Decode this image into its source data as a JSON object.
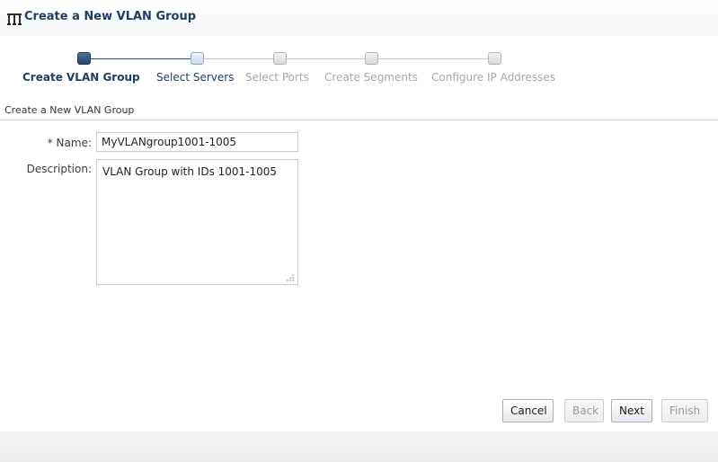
{
  "dialog": {
    "title": "Create a New VLAN Group",
    "icon": "vlan-group-icon"
  },
  "train": {
    "steps": [
      {
        "label": "Create VLAN Group",
        "state": "current"
      },
      {
        "label": "Select Servers",
        "state": "visited"
      },
      {
        "label": "Select Ports",
        "state": "disabled"
      },
      {
        "label": "Create Segments",
        "state": "disabled"
      },
      {
        "label": "Configure IP Addresses",
        "state": "disabled"
      }
    ]
  },
  "section": {
    "title": "Create a New VLAN Group"
  },
  "form": {
    "name_label": "Name:",
    "required_marker": "*",
    "name_value": "MyVLANgroup1001-1005",
    "description_label": "Description:",
    "description_value": "VLAN Group with IDs 1001-1005"
  },
  "buttons": {
    "cancel": "Cancel",
    "back": "Back",
    "next": "Next",
    "finish": "Finish"
  },
  "colors": {
    "accent": "#1e3e63",
    "current_stop": "#23476b",
    "disabled_text": "#a8a8a8"
  }
}
